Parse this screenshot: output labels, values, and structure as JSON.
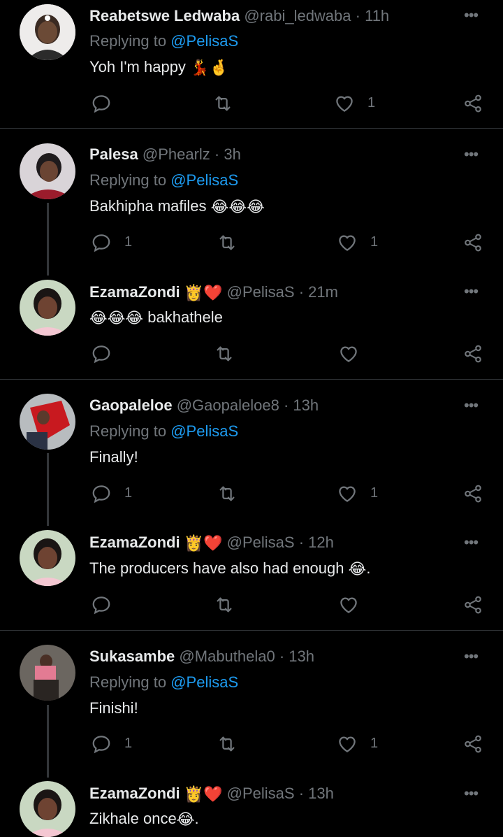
{
  "tweets": [
    {
      "name": "Reabetswe Ledwaba",
      "handle": "@rabi_ledwaba",
      "time": "· 11h",
      "replying": "Replying to",
      "mention": "@PelisaS",
      "text": "Yoh I'm happy",
      "emoji": "💃🤞",
      "replies": "",
      "likes": "1"
    },
    {
      "name": "Palesa",
      "handle": "@Phearlz",
      "time": "· 3h",
      "replying": "Replying to",
      "mention": "@PelisaS",
      "text": "Bakhipha mafiles",
      "emoji": "😂😂😂",
      "replies": "1",
      "likes": "1"
    },
    {
      "name": "EzamaZondi",
      "handle": "@PelisaS",
      "time": "· 21m",
      "replying": "",
      "mention": "",
      "text": "bakhathele",
      "emoji": "😂😂😂",
      "replies": "",
      "likes": ""
    },
    {
      "name": "Gaopaleloe",
      "handle": "@Gaopaleloe8",
      "time": "· 13h",
      "replying": "Replying to",
      "mention": "@PelisaS",
      "text": "Finally!",
      "emoji": "",
      "replies": "1",
      "likes": "1"
    },
    {
      "name": "EzamaZondi",
      "handle": "@PelisaS",
      "time": "· 12h",
      "replying": "",
      "mention": "",
      "text": "The producers have also had enough",
      "text_end": ".",
      "emoji": "😂",
      "replies": "",
      "likes": ""
    },
    {
      "name": "Sukasambe",
      "handle": "@Mabuthela0",
      "time": "· 13h",
      "replying": "Replying to",
      "mention": "@PelisaS",
      "text": "Finishi!",
      "emoji": "",
      "replies": "1",
      "likes": "1"
    },
    {
      "name": "EzamaZondi",
      "handle": "@PelisaS",
      "time": "· 13h",
      "replying": "",
      "mention": "",
      "text": "Zikhale once",
      "text_end": ".",
      "emoji": "😂",
      "replies": "",
      "likes": ""
    }
  ],
  "name_badges": "👸❤️",
  "more_label": "•••",
  "colors": {
    "accent": "#1d9bf0",
    "muted": "#71767b",
    "text": "#e7e9ea",
    "bg": "#000000"
  }
}
